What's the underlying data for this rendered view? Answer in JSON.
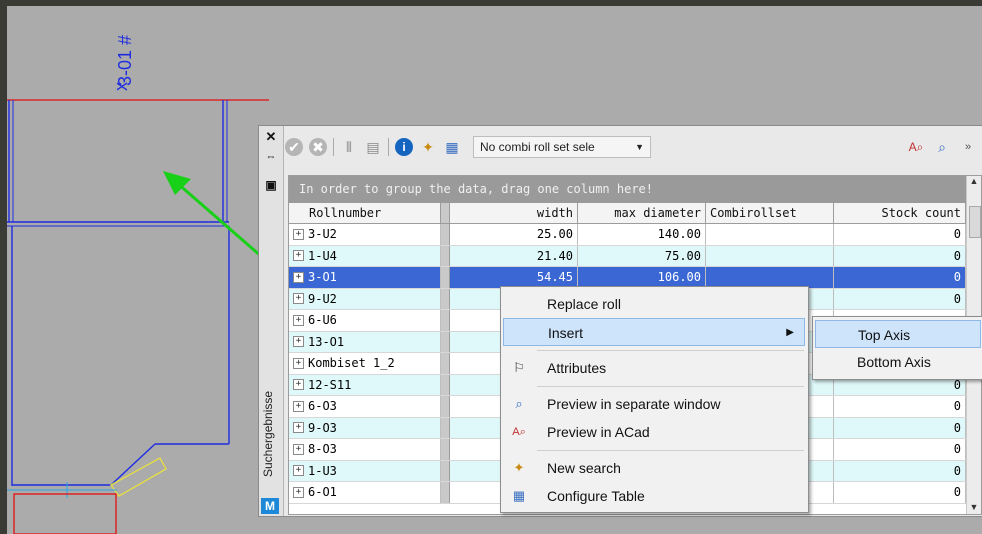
{
  "drawing": {
    "label": "3-01 #"
  },
  "panel": {
    "side_label": "Suchergebnisse",
    "logo": "M",
    "close_icon": "✕",
    "pin_icon": "⇔",
    "window_icon": "▣"
  },
  "toolbar": {
    "combo_value": "No combi roll set sele",
    "icons": [
      "check-circle-icon",
      "cancel-circle-icon",
      "bars-icon",
      "box-icon",
      "info-icon",
      "new-search-icon",
      "configure-table-icon",
      "preview-acad-icon",
      "preview-window-icon",
      "overflow-icon"
    ]
  },
  "grid": {
    "group_hint": "In order to group the data, drag one column here!",
    "columns": {
      "roll": "Rollnumber",
      "width": "width",
      "diameter": "max diameter",
      "combi": "Combirollset",
      "stock": "Stock count"
    },
    "rows": [
      {
        "roll": "3-U2",
        "width": "25.00",
        "diameter": "140.00",
        "combi": "",
        "stock": "0"
      },
      {
        "roll": "1-U4",
        "width": "21.40",
        "diameter": "75.00",
        "combi": "",
        "stock": "0"
      },
      {
        "roll": "3-O1",
        "width": "54.45",
        "diameter": "106.00",
        "combi": "",
        "stock": "0"
      },
      {
        "roll": "9-U2",
        "width": "",
        "diameter": "",
        "combi": "",
        "stock": "0"
      },
      {
        "roll": "6-U6",
        "width": "",
        "diameter": "",
        "combi": "",
        "stock": ""
      },
      {
        "roll": "13-O1",
        "width": "",
        "diameter": "",
        "combi": "",
        "stock": ""
      },
      {
        "roll": "Kombiset 1_2",
        "width": "",
        "diameter": "",
        "combi": "",
        "stock": ""
      },
      {
        "roll": "12-S11",
        "width": "",
        "diameter": "",
        "combi": "",
        "stock": "0"
      },
      {
        "roll": "6-O3",
        "width": "",
        "diameter": "",
        "combi": "",
        "stock": "0"
      },
      {
        "roll": "9-O3",
        "width": "",
        "diameter": "",
        "combi": "",
        "stock": "0"
      },
      {
        "roll": "8-O3",
        "width": "",
        "diameter": "",
        "combi": "",
        "stock": "0"
      },
      {
        "roll": "1-U3",
        "width": "",
        "diameter": "",
        "combi": "",
        "stock": "0"
      },
      {
        "roll": "6-O1",
        "width": "",
        "diameter": "",
        "combi": "",
        "stock": "0"
      }
    ]
  },
  "context_menu": {
    "replace": "Replace roll",
    "insert": "Insert",
    "attributes": "Attributes",
    "preview_window": "Preview in separate window",
    "preview_acad": "Preview in ACad",
    "new_search": "New search",
    "configure": "Configure Table"
  },
  "submenu": {
    "top": "Top Axis",
    "bottom": "Bottom Axis"
  }
}
